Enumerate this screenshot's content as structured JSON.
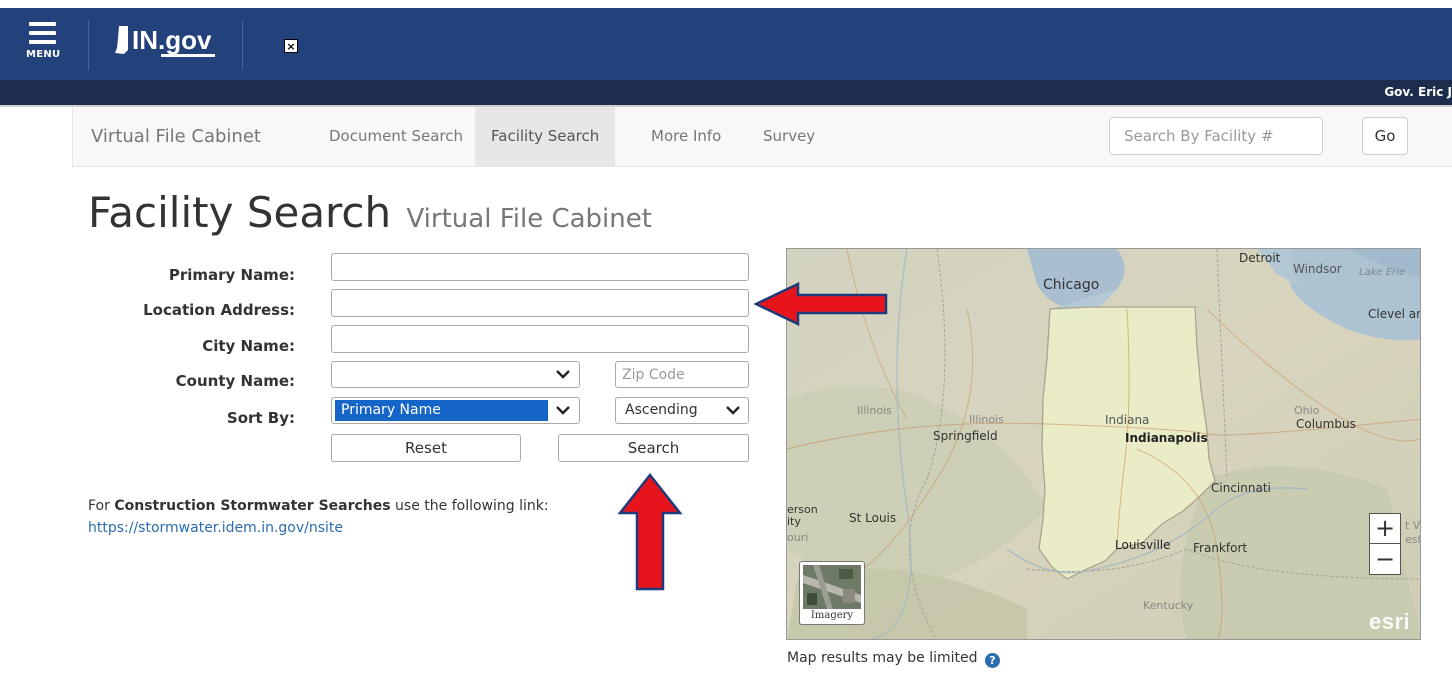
{
  "header": {
    "menu_label": "MENU",
    "logo_text": "IN.gov",
    "gov_link": "Gov. Eric J"
  },
  "navbar": {
    "brand": "Virtual File Cabinet",
    "items": [
      {
        "label": "Document Search",
        "active": false
      },
      {
        "label": "Facility Search",
        "active": true
      },
      {
        "label": "More Info",
        "active": false
      },
      {
        "label": "Survey",
        "active": false
      }
    ],
    "search_placeholder": "Search By Facility #",
    "go_label": "Go"
  },
  "page": {
    "title": "Facility Search",
    "subtitle": "Virtual File Cabinet"
  },
  "form": {
    "primary_name_label": "Primary Name:",
    "primary_name_value": "",
    "location_address_label": "Location Address:",
    "location_address_value": "",
    "city_name_label": "City Name:",
    "city_name_value": "",
    "county_name_label": "County Name:",
    "county_value": "",
    "zip_placeholder": "Zip Code",
    "sort_by_label": "Sort By:",
    "sort_by_value": "Primary Name",
    "sort_order_value": "Ascending",
    "reset_label": "Reset",
    "search_label": "Search"
  },
  "note": {
    "prefix": "For ",
    "bold": "Construction Stormwater Searches",
    "suffix": " use the following link:",
    "link": "https://stormwater.idem.in.gov/nsite"
  },
  "map": {
    "labels": {
      "chicago": "Chicago",
      "detroit": "Detroit",
      "windsor": "Windsor",
      "lake_erie": "Lake Erie",
      "cleveland": "Clevel and",
      "illinois1": "Illinois",
      "illinois2": "Illinois",
      "springfield": "Springfield",
      "indiana": "Indiana",
      "indianapolis": "Indianapolis",
      "ohio": "Ohio",
      "columbus": "Columbus",
      "cincinnati": "Cincinnati",
      "st_louis": "St Louis",
      "erson": "erson",
      "ity": "ity",
      "ouri": "ouri",
      "louisville": "Louisville",
      "frankfort": "Frankfort",
      "kentucky": "Kentucky",
      "edge_t": "t V",
      "edge_est": "est"
    },
    "zoom_in": "+",
    "zoom_out": "−",
    "imagery_label": "Imagery",
    "attribution": "esri",
    "note": "Map results may be limited",
    "help_icon": "?"
  },
  "colors": {
    "header_bg": "#23417a",
    "subbar_bg": "#1c2d4e",
    "annotation_arrow": "#e8141c"
  }
}
